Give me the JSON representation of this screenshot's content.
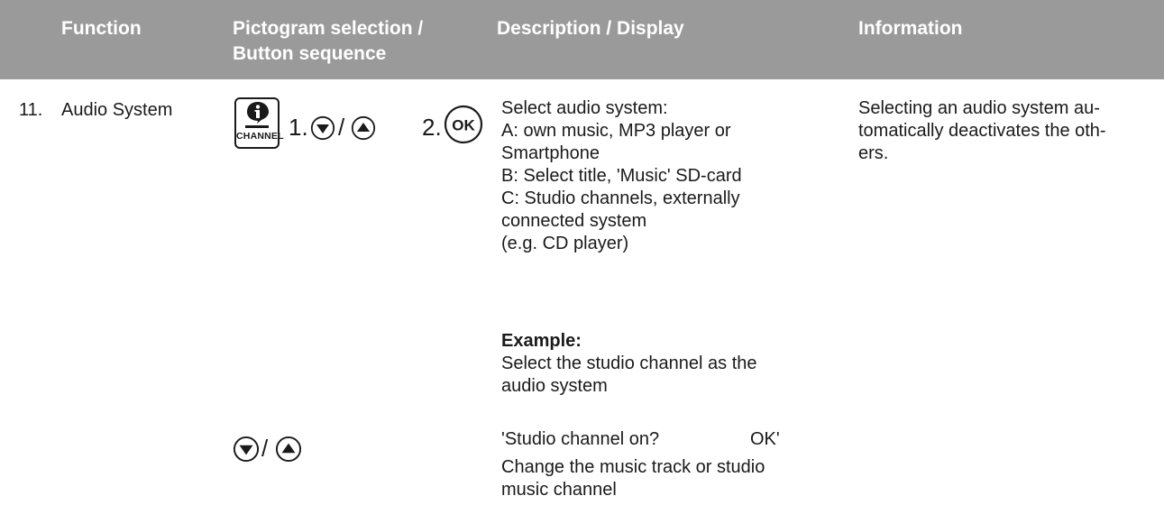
{
  "table_header": {
    "function": "Function",
    "pictogram_line1": "Pictogram selection /",
    "pictogram_line2": "Button sequence",
    "description": "Description / Display",
    "information": "Information"
  },
  "row": {
    "number": "11.",
    "function": "Audio System",
    "channel_button_label": "CHANNEL",
    "step1_label": "1.",
    "step2_label": "2.",
    "slash": "/",
    "ok_icon_text": "OK",
    "description_lines": [
      "Select audio system:",
      "A: own music, MP3 player or",
      "Smartphone",
      "B: Select title, 'Music' SD-card",
      "C: Studio channels, externally",
      "connected system",
      "(e.g. CD player)"
    ],
    "example_title": "Example:",
    "example_lines": [
      "Select the studio channel as the",
      "audio system"
    ],
    "display_text": "'Studio channel on?",
    "display_ok": "OK'",
    "change_lines": [
      "Change the music track or studio",
      "music channel"
    ],
    "information_lines": [
      "Selecting an audio system au-",
      "tomatically deactivates the oth-",
      "ers."
    ]
  }
}
